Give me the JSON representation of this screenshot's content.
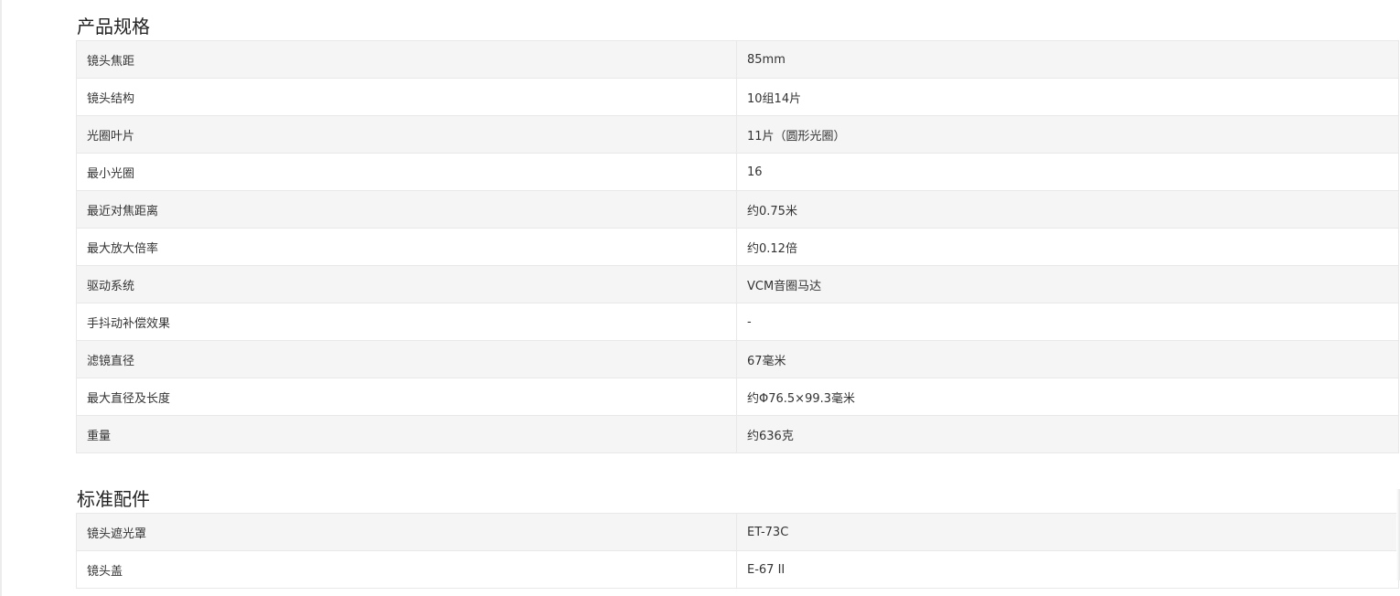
{
  "sections": [
    {
      "title": "产品规格",
      "rows": [
        {
          "label": "镜头焦距",
          "value": "85mm"
        },
        {
          "label": "镜头结构",
          "value": "10组14片"
        },
        {
          "label": "光圈叶片",
          "value": "11片（圆形光圈）"
        },
        {
          "label": "最小光圈",
          "value": "16"
        },
        {
          "label": "最近对焦距离",
          "value": "约0.75米"
        },
        {
          "label": "最大放大倍率",
          "value": "约0.12倍"
        },
        {
          "label": "驱动系统",
          "value": "VCM音圈马达"
        },
        {
          "label": "手抖动补偿效果",
          "value": "-"
        },
        {
          "label": "滤镜直径",
          "value": "67毫米"
        },
        {
          "label": "最大直径及长度",
          "value": "约Φ76.5×99.3毫米"
        },
        {
          "label": "重量",
          "value": "约636克"
        }
      ]
    },
    {
      "title": "标准配件",
      "rows": [
        {
          "label": "镜头遮光罩",
          "value": "ET-73C"
        },
        {
          "label": "镜头盖",
          "value": "E-67 II"
        }
      ]
    }
  ]
}
